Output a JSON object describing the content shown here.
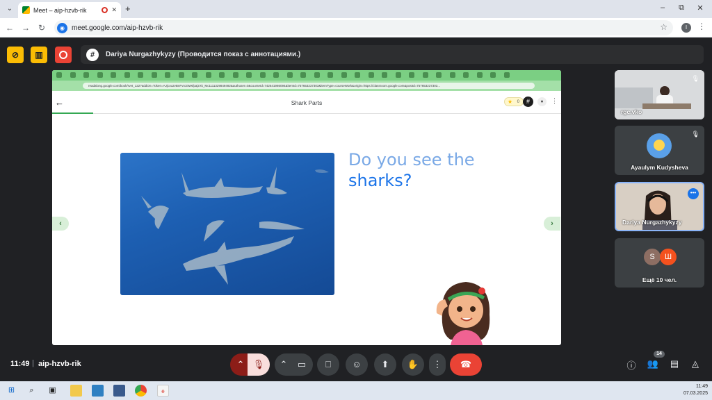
{
  "browser": {
    "tab_title": "Meet – aip-hzvb-rik",
    "new_tab": "+",
    "url": "meet.google.com/aip-hzvb-rik",
    "profile_initial": "I",
    "window_minimize": "–",
    "window_restore": "⧉",
    "window_close": "✕"
  },
  "meet": {
    "presenter_text": "Dariya Nurgazhykyzy (Проводится показ с аннотациями.)",
    "clock": "11:49",
    "separator": "|",
    "meeting_code": "aip-hzvb-rik",
    "participants_count": "14",
    "participants": [
      {
        "name": "rgc.vko",
        "muted": true
      },
      {
        "name": "Ayaulym Kudysheva",
        "muted": true
      },
      {
        "name": "Dariya Nurgazhykyzy",
        "muted": false,
        "active": true
      },
      {
        "name": "Ещё 10 чел.",
        "initials": [
          "S",
          "Ш"
        ]
      }
    ]
  },
  "shared_screen": {
    "inner_url": "readalong.google.com/book/rvet_122?addOn=Token=AJjcou2vBnFvn1tWwfpajzXk_Mc1111329849492&authuser=0&courseId=742641986094&itemId=757653237303&itemType=courseWork&origin=https://classroom.google.com&postId=757653237303...",
    "book_title": "Shark Parts",
    "stars_count": "0",
    "progress_fraction": 0.08,
    "story_line1": "Do you see the",
    "story_line2": "sharks?",
    "prev_arrow": "‹",
    "next_arrow": "›"
  },
  "taskbar": {
    "time": "11:49",
    "date": "07.03.2025"
  },
  "colors": {
    "meet_bg": "#202124",
    "accent_blue": "#1a73e8",
    "end_call_red": "#ea4335",
    "readalong_green": "#7bcf83"
  }
}
